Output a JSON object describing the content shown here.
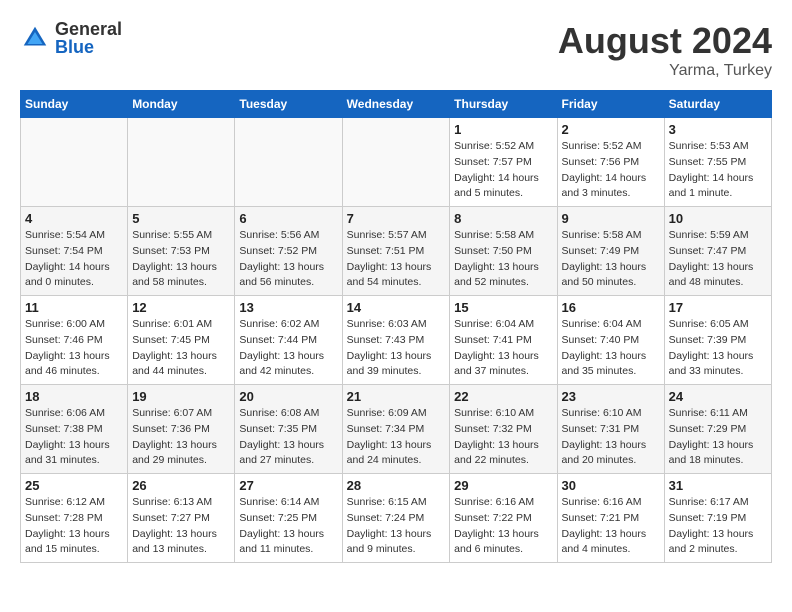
{
  "header": {
    "logo_general": "General",
    "logo_blue": "Blue",
    "month_title": "August 2024",
    "location": "Yarma, Turkey"
  },
  "weekdays": [
    "Sunday",
    "Monday",
    "Tuesday",
    "Wednesday",
    "Thursday",
    "Friday",
    "Saturday"
  ],
  "weeks": [
    [
      {
        "day": "",
        "sunrise": "",
        "sunset": "",
        "daylight": ""
      },
      {
        "day": "",
        "sunrise": "",
        "sunset": "",
        "daylight": ""
      },
      {
        "day": "",
        "sunrise": "",
        "sunset": "",
        "daylight": ""
      },
      {
        "day": "",
        "sunrise": "",
        "sunset": "",
        "daylight": ""
      },
      {
        "day": "1",
        "sunrise": "Sunrise: 5:52 AM",
        "sunset": "Sunset: 7:57 PM",
        "daylight": "Daylight: 14 hours and 5 minutes."
      },
      {
        "day": "2",
        "sunrise": "Sunrise: 5:52 AM",
        "sunset": "Sunset: 7:56 PM",
        "daylight": "Daylight: 14 hours and 3 minutes."
      },
      {
        "day": "3",
        "sunrise": "Sunrise: 5:53 AM",
        "sunset": "Sunset: 7:55 PM",
        "daylight": "Daylight: 14 hours and 1 minute."
      }
    ],
    [
      {
        "day": "4",
        "sunrise": "Sunrise: 5:54 AM",
        "sunset": "Sunset: 7:54 PM",
        "daylight": "Daylight: 14 hours and 0 minutes."
      },
      {
        "day": "5",
        "sunrise": "Sunrise: 5:55 AM",
        "sunset": "Sunset: 7:53 PM",
        "daylight": "Daylight: 13 hours and 58 minutes."
      },
      {
        "day": "6",
        "sunrise": "Sunrise: 5:56 AM",
        "sunset": "Sunset: 7:52 PM",
        "daylight": "Daylight: 13 hours and 56 minutes."
      },
      {
        "day": "7",
        "sunrise": "Sunrise: 5:57 AM",
        "sunset": "Sunset: 7:51 PM",
        "daylight": "Daylight: 13 hours and 54 minutes."
      },
      {
        "day": "8",
        "sunrise": "Sunrise: 5:58 AM",
        "sunset": "Sunset: 7:50 PM",
        "daylight": "Daylight: 13 hours and 52 minutes."
      },
      {
        "day": "9",
        "sunrise": "Sunrise: 5:58 AM",
        "sunset": "Sunset: 7:49 PM",
        "daylight": "Daylight: 13 hours and 50 minutes."
      },
      {
        "day": "10",
        "sunrise": "Sunrise: 5:59 AM",
        "sunset": "Sunset: 7:47 PM",
        "daylight": "Daylight: 13 hours and 48 minutes."
      }
    ],
    [
      {
        "day": "11",
        "sunrise": "Sunrise: 6:00 AM",
        "sunset": "Sunset: 7:46 PM",
        "daylight": "Daylight: 13 hours and 46 minutes."
      },
      {
        "day": "12",
        "sunrise": "Sunrise: 6:01 AM",
        "sunset": "Sunset: 7:45 PM",
        "daylight": "Daylight: 13 hours and 44 minutes."
      },
      {
        "day": "13",
        "sunrise": "Sunrise: 6:02 AM",
        "sunset": "Sunset: 7:44 PM",
        "daylight": "Daylight: 13 hours and 42 minutes."
      },
      {
        "day": "14",
        "sunrise": "Sunrise: 6:03 AM",
        "sunset": "Sunset: 7:43 PM",
        "daylight": "Daylight: 13 hours and 39 minutes."
      },
      {
        "day": "15",
        "sunrise": "Sunrise: 6:04 AM",
        "sunset": "Sunset: 7:41 PM",
        "daylight": "Daylight: 13 hours and 37 minutes."
      },
      {
        "day": "16",
        "sunrise": "Sunrise: 6:04 AM",
        "sunset": "Sunset: 7:40 PM",
        "daylight": "Daylight: 13 hours and 35 minutes."
      },
      {
        "day": "17",
        "sunrise": "Sunrise: 6:05 AM",
        "sunset": "Sunset: 7:39 PM",
        "daylight": "Daylight: 13 hours and 33 minutes."
      }
    ],
    [
      {
        "day": "18",
        "sunrise": "Sunrise: 6:06 AM",
        "sunset": "Sunset: 7:38 PM",
        "daylight": "Daylight: 13 hours and 31 minutes."
      },
      {
        "day": "19",
        "sunrise": "Sunrise: 6:07 AM",
        "sunset": "Sunset: 7:36 PM",
        "daylight": "Daylight: 13 hours and 29 minutes."
      },
      {
        "day": "20",
        "sunrise": "Sunrise: 6:08 AM",
        "sunset": "Sunset: 7:35 PM",
        "daylight": "Daylight: 13 hours and 27 minutes."
      },
      {
        "day": "21",
        "sunrise": "Sunrise: 6:09 AM",
        "sunset": "Sunset: 7:34 PM",
        "daylight": "Daylight: 13 hours and 24 minutes."
      },
      {
        "day": "22",
        "sunrise": "Sunrise: 6:10 AM",
        "sunset": "Sunset: 7:32 PM",
        "daylight": "Daylight: 13 hours and 22 minutes."
      },
      {
        "day": "23",
        "sunrise": "Sunrise: 6:10 AM",
        "sunset": "Sunset: 7:31 PM",
        "daylight": "Daylight: 13 hours and 20 minutes."
      },
      {
        "day": "24",
        "sunrise": "Sunrise: 6:11 AM",
        "sunset": "Sunset: 7:29 PM",
        "daylight": "Daylight: 13 hours and 18 minutes."
      }
    ],
    [
      {
        "day": "25",
        "sunrise": "Sunrise: 6:12 AM",
        "sunset": "Sunset: 7:28 PM",
        "daylight": "Daylight: 13 hours and 15 minutes."
      },
      {
        "day": "26",
        "sunrise": "Sunrise: 6:13 AM",
        "sunset": "Sunset: 7:27 PM",
        "daylight": "Daylight: 13 hours and 13 minutes."
      },
      {
        "day": "27",
        "sunrise": "Sunrise: 6:14 AM",
        "sunset": "Sunset: 7:25 PM",
        "daylight": "Daylight: 13 hours and 11 minutes."
      },
      {
        "day": "28",
        "sunrise": "Sunrise: 6:15 AM",
        "sunset": "Sunset: 7:24 PM",
        "daylight": "Daylight: 13 hours and 9 minutes."
      },
      {
        "day": "29",
        "sunrise": "Sunrise: 6:16 AM",
        "sunset": "Sunset: 7:22 PM",
        "daylight": "Daylight: 13 hours and 6 minutes."
      },
      {
        "day": "30",
        "sunrise": "Sunrise: 6:16 AM",
        "sunset": "Sunset: 7:21 PM",
        "daylight": "Daylight: 13 hours and 4 minutes."
      },
      {
        "day": "31",
        "sunrise": "Sunrise: 6:17 AM",
        "sunset": "Sunset: 7:19 PM",
        "daylight": "Daylight: 13 hours and 2 minutes."
      }
    ]
  ]
}
